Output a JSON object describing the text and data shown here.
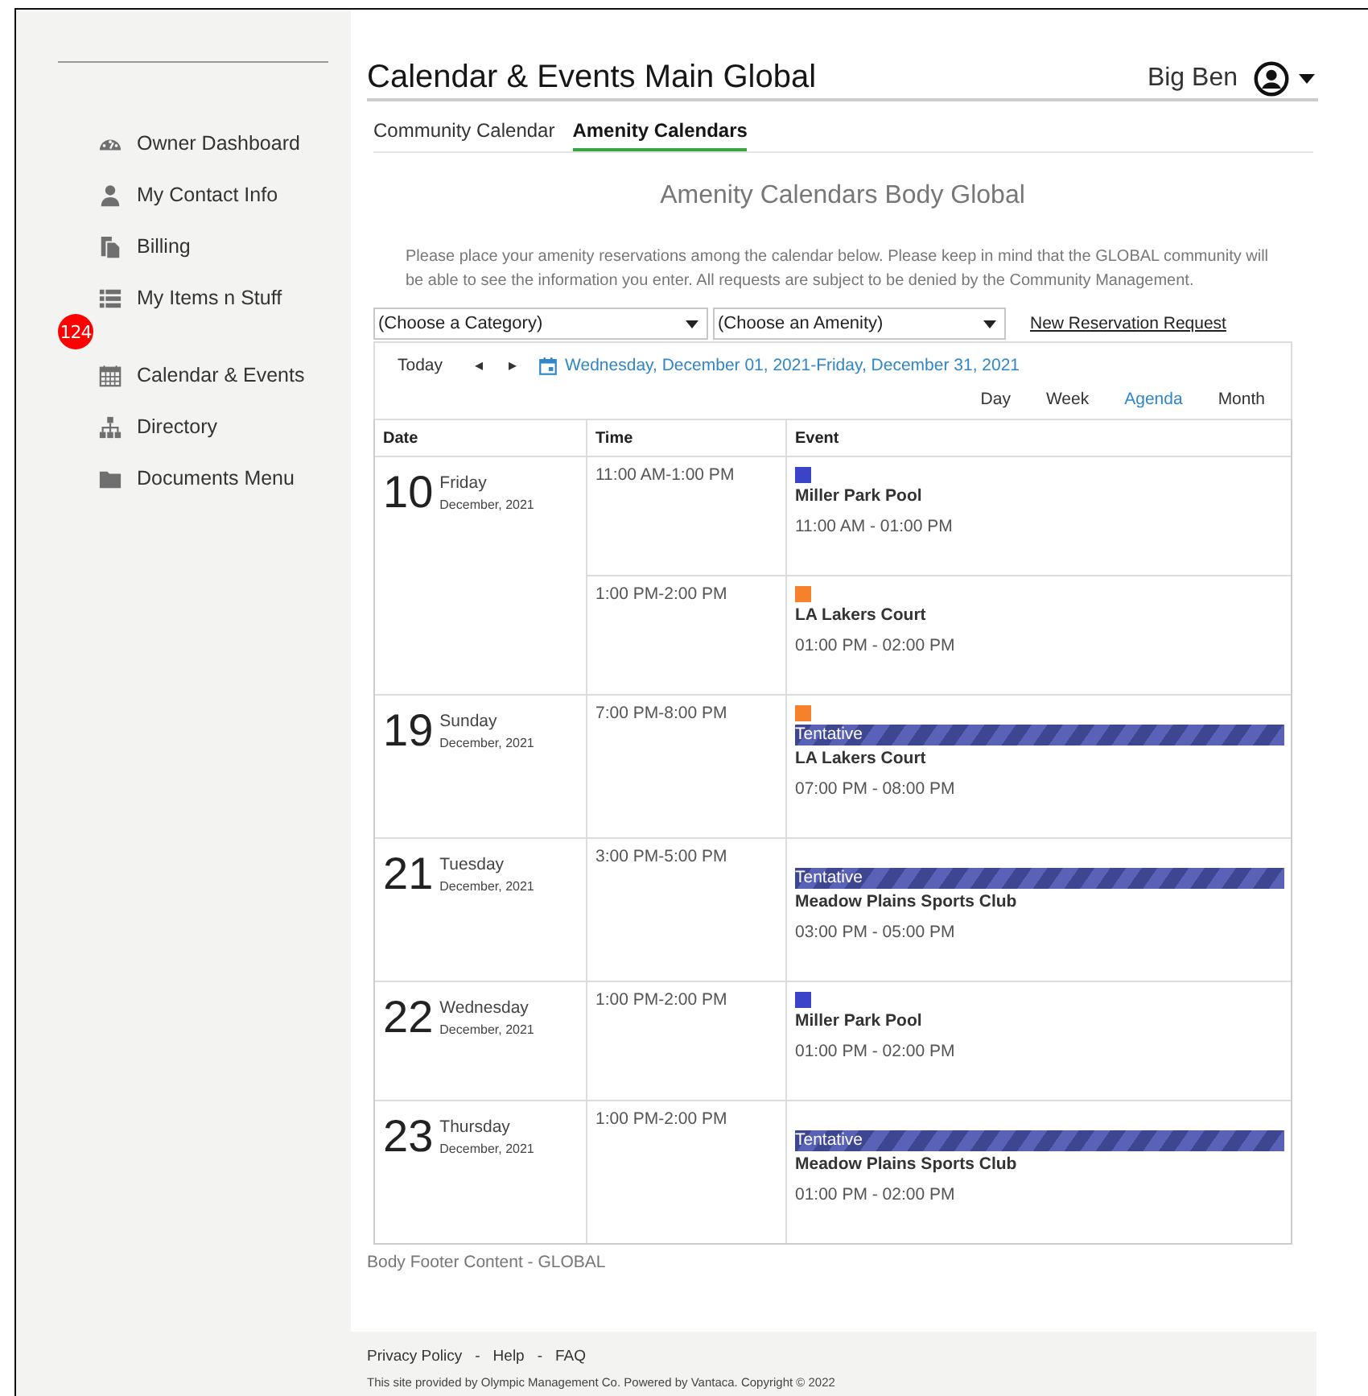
{
  "sidebar": {
    "items": [
      {
        "label": "Owner Dashboard"
      },
      {
        "label": "My Contact Info"
      },
      {
        "label": "Billing"
      },
      {
        "label": "My Items n Stuff",
        "badge": "124"
      },
      {
        "label": "Calendar & Events"
      },
      {
        "label": "Directory"
      },
      {
        "label": "Documents Menu"
      }
    ]
  },
  "header": {
    "title": "Calendar & Events Main Global",
    "user": "Big Ben"
  },
  "tabs": [
    {
      "label": "Community Calendar",
      "selected": false
    },
    {
      "label": "Amenity Calendars",
      "selected": true
    }
  ],
  "body_title": "Amenity Calendars Body Global",
  "intro": "Please place your amenity reservations among the calendar below. Please keep in mind that the GLOBAL community will be able to see the information you enter. All requests are subject to be denied by the Community Management.",
  "filters": {
    "category": "(Choose a Category)",
    "amenity": "(Choose an Amenity)",
    "link": "New Reservation Request"
  },
  "toolbar": {
    "today": "Today",
    "prev": "◂",
    "next": "▸",
    "range": "Wednesday, December 01, 2021-Friday, December 31, 2021",
    "views": [
      {
        "label": "Day",
        "selected": false
      },
      {
        "label": "Week",
        "selected": false
      },
      {
        "label": "Agenda",
        "selected": true
      },
      {
        "label": "Month",
        "selected": false
      }
    ]
  },
  "table": {
    "columns": [
      "Date",
      "Time",
      "Event"
    ],
    "days": [
      {
        "day": "10",
        "weekday": "Friday",
        "month": "December, 2021",
        "entries": [
          {
            "time": "11:00 AM-1:00 PM",
            "color": "#3b44c8",
            "tentative": false,
            "name": "Miller Park Pool",
            "range": "11:00 AM - 01:00 PM"
          },
          {
            "time": "1:00 PM-2:00 PM",
            "color": "#f5822a",
            "tentative": false,
            "name": "LA Lakers Court",
            "range": "01:00 PM - 02:00 PM"
          }
        ]
      },
      {
        "day": "19",
        "weekday": "Sunday",
        "month": "December, 2021",
        "entries": [
          {
            "time": "7:00 PM-8:00 PM",
            "color": "#f5822a",
            "tentative": true,
            "tentative_label": "Tentative",
            "name": "LA Lakers Court",
            "range": "07:00 PM - 08:00 PM"
          }
        ]
      },
      {
        "day": "21",
        "weekday": "Tuesday",
        "month": "December, 2021",
        "entries": [
          {
            "time": "3:00 PM-5:00 PM",
            "tentative": true,
            "tentative_label": "Tentative",
            "name": "Meadow Plains Sports Club",
            "range": "03:00 PM - 05:00 PM"
          }
        ]
      },
      {
        "day": "22",
        "weekday": "Wednesday",
        "month": "December, 2021",
        "entries": [
          {
            "time": "1:00 PM-2:00 PM",
            "color": "#3b44c8",
            "tentative": false,
            "name": "Miller Park Pool",
            "range": "01:00 PM - 02:00 PM"
          }
        ]
      },
      {
        "day": "23",
        "weekday": "Thursday",
        "month": "December, 2021",
        "entries": [
          {
            "time": "1:00 PM-2:00 PM",
            "tentative": true,
            "tentative_label": "Tentative",
            "name": "Meadow Plains Sports Club",
            "range": "01:00 PM - 02:00 PM"
          }
        ]
      }
    ]
  },
  "body_footer": "Body Footer Content - GLOBAL",
  "footer": {
    "links": [
      "Privacy Policy",
      "Help",
      "FAQ"
    ],
    "separator": "-",
    "credit": "This site provided by Olympic Management Co. Powered by Vantaca. Copyright © 2022"
  }
}
